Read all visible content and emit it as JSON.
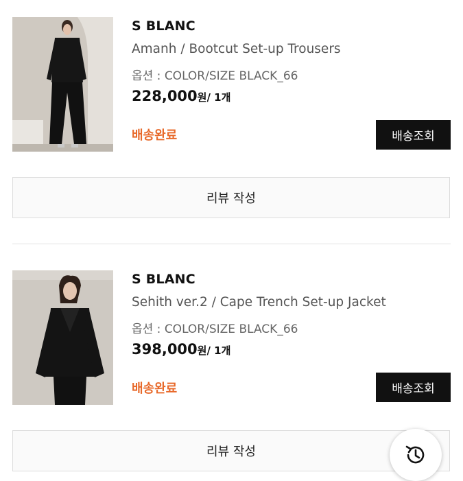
{
  "orders": [
    {
      "brand": "S BLANC",
      "name": "Amanh / Bootcut Set-up Trousers",
      "option": "옵션 : COLOR/SIZE BLACK_66",
      "price": "228,000",
      "won": "원",
      "qty": "/ 1개",
      "status": "배송완료",
      "track_label": "배송조회",
      "review_label": "리뷰 작성"
    },
    {
      "brand": "S BLANC",
      "name": "Sehith ver.2 / Cape Trench Set-up Jacket",
      "option": "옵션 : COLOR/SIZE BLACK_66",
      "price": "398,000",
      "won": "원",
      "qty": "/ 1개",
      "status": "배송완료",
      "track_label": "배송조회",
      "review_label": "리뷰 작성"
    }
  ],
  "fab": {
    "icon": "history-clock-icon"
  },
  "colors": {
    "status": "#e8692a",
    "button": "#111111"
  }
}
